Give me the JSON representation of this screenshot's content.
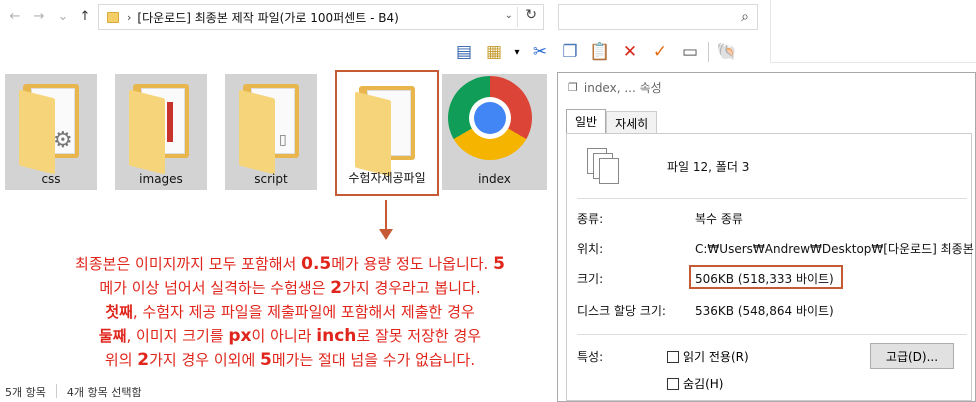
{
  "explorer": {
    "path_chevron": "›",
    "path_text": "[다운로드] 최종본 제작 파일(가로 100퍼센트 - B4)",
    "items": [
      {
        "label": "css",
        "kind": "folder-gear"
      },
      {
        "label": "images",
        "kind": "folder-images"
      },
      {
        "label": "script",
        "kind": "folder-script"
      },
      {
        "label": "수험자제공파일",
        "kind": "folder-doc",
        "selected": true
      },
      {
        "label": "index",
        "kind": "chrome"
      }
    ],
    "status": {
      "count": "5개 항목",
      "selected": "4개 항목 선택함"
    }
  },
  "notes": {
    "line1_a": "최종본은 이미지까지 모두 포함해서 ",
    "line1_b": "0.5",
    "line1_c": "메가 용량 정도 나옵니다. ",
    "line1_d": "5",
    "line2_a": "메가 이상 넘어서 실격하는 수험생은 ",
    "line2_b": "2",
    "line2_c": "가지 경우라고 봅니다.",
    "line3_a": "첫째",
    "line3_b": ", 수험자 제공 파일을 제출파일에 포함해서 제출한 경우",
    "line4_a": "둘째",
    "line4_b": ", 이미지 크기를 ",
    "line4_c": "px",
    "line4_d": "이 아니라 ",
    "line4_e": "inch",
    "line4_f": "로 잘못 저장한 경우",
    "line5_a": "위의 ",
    "line5_b": "2",
    "line5_c": "가지 경우 이외에 ",
    "line5_d": "5",
    "line5_e": "메가는 절대 넘을 수가 없습니다."
  },
  "properties": {
    "title": "index, ... 속성",
    "tabs": [
      "일반",
      "자세히"
    ],
    "summary": "파일 12, 폴더 3",
    "type_label": "종류:",
    "type_value": "복수 종류",
    "location_label": "위치:",
    "location_value": "C:₩Users₩Andrew₩Desktop₩[다운로드] 최종본",
    "size_label": "크기:",
    "size_value": "506KB (518,333 바이트)",
    "disk_label": "디스크 할당 크기:",
    "disk_value": "536KB (548,864 바이트)",
    "attr_label": "특성:",
    "readonly_label": "읽기 전용(R)",
    "hidden_label": "숨김(H)",
    "advanced_button": "고급(D)..."
  },
  "colors": {
    "accent_box": "#c55a34",
    "note_red": "#e0261c"
  }
}
